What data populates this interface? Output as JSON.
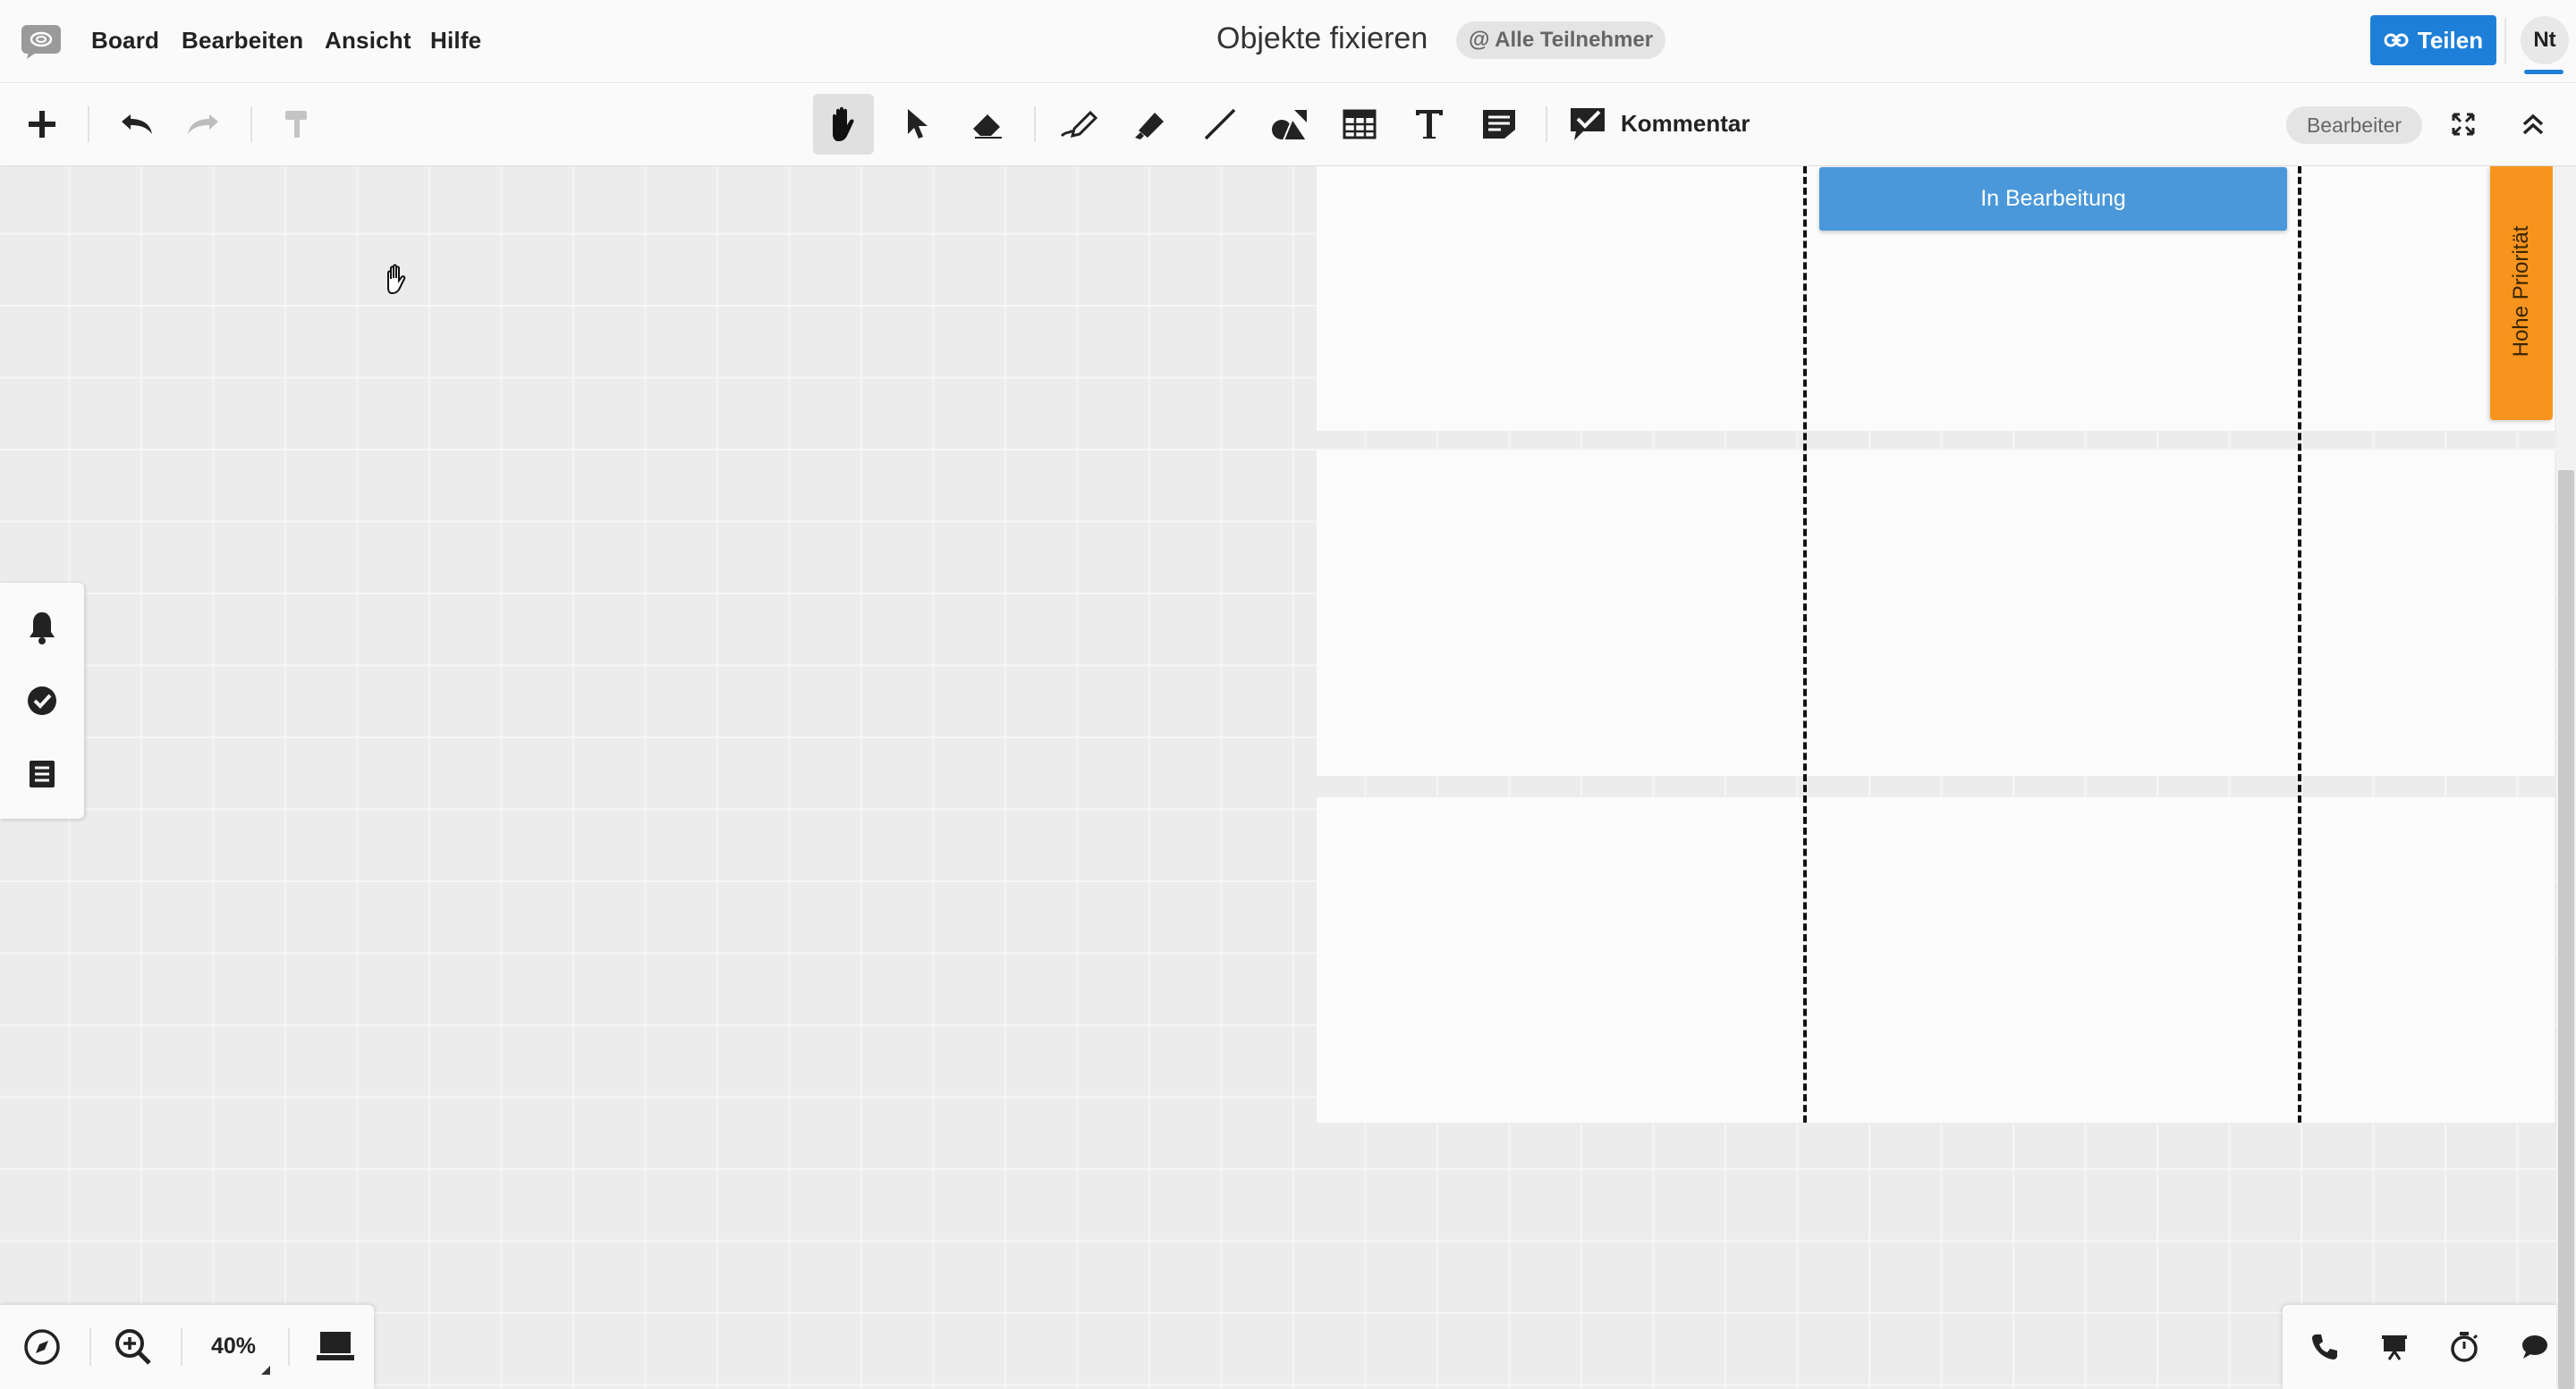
{
  "menubar": {
    "items": [
      "Board",
      "Bearbeiten",
      "Ansicht",
      "Hilfe"
    ],
    "board_title": "Objekte fixieren",
    "audience_badge": "@ Alle Teilnehmer",
    "share_label": "Teilen",
    "user_initials": "Nt"
  },
  "toolbar": {
    "comment_label": "Kommentar",
    "editor_label": "Bearbeiter",
    "tools": [
      "add-icon",
      "undo-icon",
      "redo-icon",
      "format-painter-icon",
      "hand-icon",
      "pointer-icon",
      "eraser-icon",
      "pen-icon",
      "highlighter-icon",
      "line-icon",
      "shapes-icon",
      "table-icon",
      "text-icon",
      "sticky-note-icon",
      "comment-icon",
      "fullscreen-icon",
      "collapse-icon"
    ]
  },
  "board": {
    "status_card": "In Bearbeitung",
    "priority_label": "Hohe Priorität"
  },
  "side_panel": {
    "icons": [
      "bell-icon",
      "check-circle-icon",
      "list-icon"
    ]
  },
  "bottom_left": {
    "zoom_level": "40%",
    "icons": [
      "compass-icon",
      "zoom-in-icon",
      "presentation-screen-icon"
    ]
  },
  "bottom_right": {
    "icons": [
      "phone-icon",
      "presentation-icon",
      "timer-icon",
      "chat-icon"
    ]
  },
  "colors": {
    "accent": "#1e7fd8",
    "status_card": "#4a98d9",
    "priority_tab": "#f7941e"
  }
}
